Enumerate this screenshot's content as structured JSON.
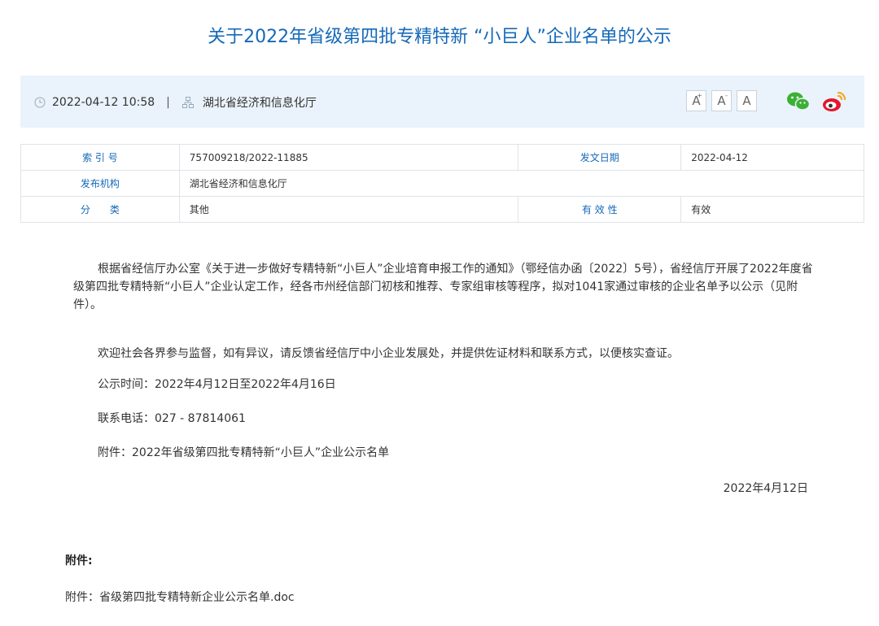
{
  "header": {
    "title": "关于2022年省级第四批专精特新 “小巨人”企业名单的公示"
  },
  "meta": {
    "datetime": "2022-04-12 10:58",
    "separator": "|",
    "source": "湖北省经济和信息化厅",
    "font_large": "A",
    "font_medium": "A",
    "font_small": "A",
    "font_large_sup": "+",
    "font_medium_sup": "-"
  },
  "info_table": {
    "index_label": "索 引 号",
    "index_value": "757009218/2022-11885",
    "date_label": "发文日期",
    "date_value": "2022-04-12",
    "org_label": "发布机构",
    "org_value": "湖北省经济和信息化厅",
    "category_label": "分　　类",
    "category_value": "其他",
    "validity_label": "有 效 性",
    "validity_value": "有效"
  },
  "body": {
    "paragraph_1": "根据省经信厅办公室《关于进一步做好专精特新“小巨人”企业培育申报工作的通知》（鄂经信办函〔2022〕5号），省经信厅开展了2022年度省级第四批专精特新“小巨人”企业认定工作，经各市州经信部门初核和推荐、专家组审核等程序，拟对1041家通过审核的企业名单予以公示（见附件）。",
    "paragraph_2": "欢迎社会各界参与监督，如有异议，请反馈省经信厅中小企业发展处，并提供佐证材料和联系方式，以便核实查证。",
    "paragraph_3": "公示时间：2022年4月12日至2022年4月16日",
    "paragraph_4": "联系电话：027 - 87814061",
    "paragraph_5": "附件：2022年省级第四批专精特新“小巨人”企业公示名单",
    "sign_date": "2022年4月12日"
  },
  "attachments": {
    "heading": "附件:",
    "item_1": "附件：省级第四批专精特新企业公示名单.doc"
  },
  "colors": {
    "title_blue": "#1569b8",
    "meta_bg": "#eaf3fb",
    "wechat_green": "#3cb034",
    "weibo_red": "#e6162d",
    "weibo_orange": "#f5a623"
  },
  "icons": {
    "clock": "clock-icon",
    "org": "org-chart-icon",
    "wechat": "wechat-icon",
    "weibo": "weibo-icon"
  }
}
